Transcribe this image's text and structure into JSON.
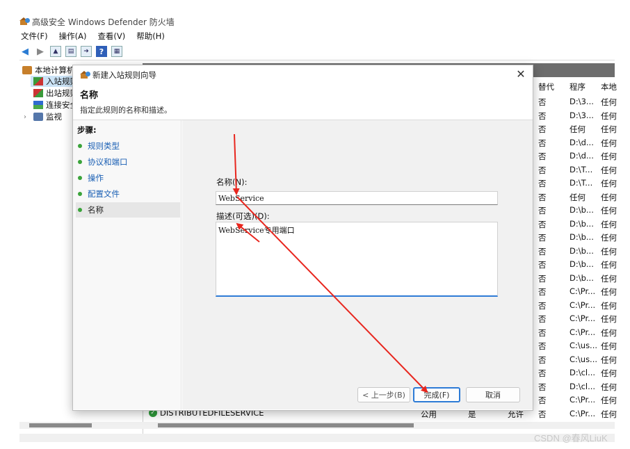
{
  "app": {
    "title": "高级安全 Windows Defender 防火墙"
  },
  "menu": [
    "文件(F)",
    "操作(A)",
    "查看(V)",
    "帮助(H)"
  ],
  "tree": {
    "items": [
      {
        "label": "本地计算机"
      },
      {
        "label": "入站规则"
      },
      {
        "label": "出站规则"
      },
      {
        "label": "连接安全"
      },
      {
        "label": "监视"
      }
    ]
  },
  "list": {
    "columns": [
      "替代",
      "程序",
      "本地"
    ],
    "rows": [
      [
        "否",
        "D:\\3...",
        "任何"
      ],
      [
        "否",
        "D:\\3...",
        "任何"
      ],
      [
        "否",
        "任何",
        "任何"
      ],
      [
        "否",
        "D:\\d...",
        "任何"
      ],
      [
        "否",
        "D:\\d...",
        "任何"
      ],
      [
        "否",
        "D:\\T...",
        "任何"
      ],
      [
        "否",
        "D:\\T...",
        "任何"
      ],
      [
        "否",
        "任何",
        "任何"
      ],
      [
        "否",
        "D:\\b...",
        "任何"
      ],
      [
        "否",
        "D:\\b...",
        "任何"
      ],
      [
        "否",
        "D:\\b...",
        "任何"
      ],
      [
        "否",
        "D:\\b...",
        "任何"
      ],
      [
        "否",
        "D:\\b...",
        "任何"
      ],
      [
        "否",
        "D:\\b...",
        "任何"
      ],
      [
        "否",
        "C:\\Pr...",
        "任何"
      ],
      [
        "否",
        "C:\\Pr...",
        "任何"
      ],
      [
        "否",
        "C:\\Pr...",
        "任何"
      ],
      [
        "否",
        "C:\\Pr...",
        "任何"
      ],
      [
        "否",
        "C:\\us...",
        "任何"
      ],
      [
        "否",
        "C:\\us...",
        "任何"
      ],
      [
        "否",
        "D:\\cl...",
        "任何"
      ],
      [
        "否",
        "D:\\cl...",
        "任何"
      ],
      [
        "否",
        "C:\\Pr...",
        "任何"
      ],
      [
        "否",
        "C:\\Pr...",
        "任何"
      ]
    ],
    "behind_row": {
      "name": "DISTRIBUTEDFILESERVICE",
      "profile": "公用",
      "enabled": "是",
      "action": "允许"
    }
  },
  "dialog": {
    "title": "新建入站规则向导",
    "close": "✕",
    "heading": "名称",
    "subtitle": "指定此规则的名称和描述。",
    "steps_title": "步骤:",
    "steps": [
      "规则类型",
      "协议和端口",
      "操作",
      "配置文件",
      "名称"
    ],
    "name_label": "名称(N):",
    "name_value": "WebService",
    "desc_label": "描述(可选)(D):",
    "desc_value": "WebService专用端口",
    "buttons": {
      "back": "< 上一步(B)",
      "finish": "完成(F)",
      "cancel": "取消"
    }
  },
  "watermark": "CSDN @春风LiuK",
  "annotation_color": "#e8261e"
}
